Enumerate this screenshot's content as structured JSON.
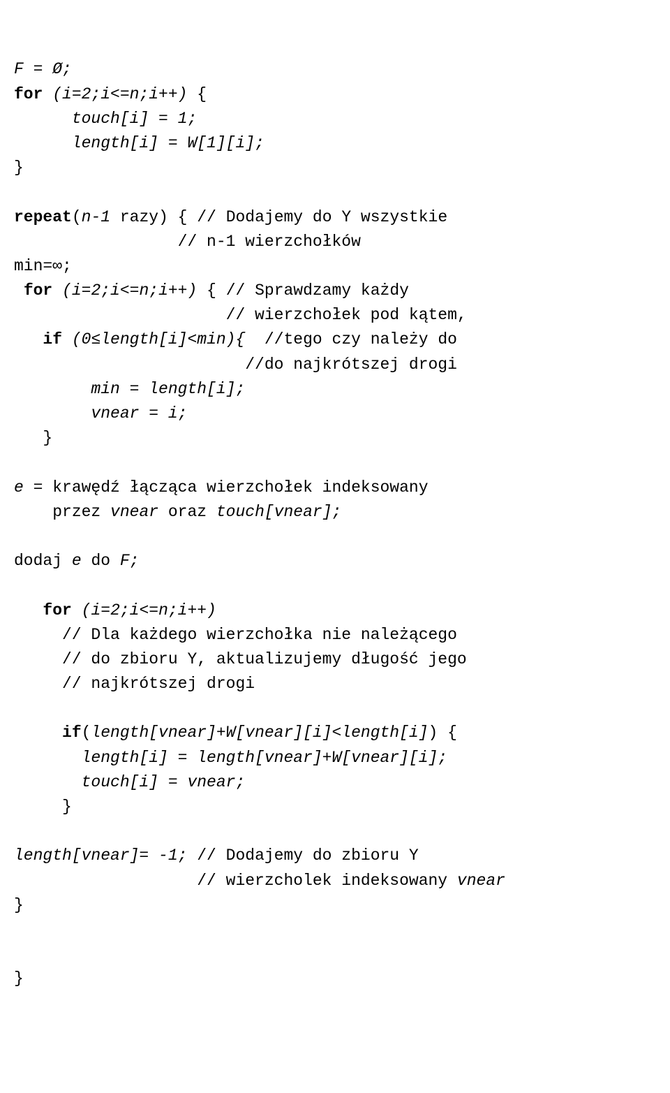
{
  "lines": [
    {
      "segs": [
        {
          "t": "F = Ø;",
          "i": true
        }
      ]
    },
    {
      "segs": [
        {
          "t": "for",
          "b": true
        },
        {
          "t": " "
        },
        {
          "t": "(i=2;i<=n;i++)",
          "i": true
        },
        {
          "t": " {"
        }
      ]
    },
    {
      "segs": [
        {
          "t": "      "
        },
        {
          "t": "touch[i] = 1;",
          "i": true
        }
      ]
    },
    {
      "segs": [
        {
          "t": "      "
        },
        {
          "t": "length[i] = W[1][i];",
          "i": true
        }
      ]
    },
    {
      "segs": [
        {
          "t": "}"
        }
      ]
    },
    {
      "segs": [
        {
          "t": ""
        }
      ]
    },
    {
      "segs": [
        {
          "t": "repeat",
          "b": true
        },
        {
          "t": "("
        },
        {
          "t": "n-1",
          "i": true
        },
        {
          "t": " razy) { // Dodajemy do Y wszystkie"
        }
      ]
    },
    {
      "segs": [
        {
          "t": "                 // n-1 wierzchołków"
        }
      ]
    },
    {
      "segs": [
        {
          "t": "min=∞;"
        }
      ]
    },
    {
      "segs": [
        {
          "t": " "
        },
        {
          "t": "for",
          "b": true
        },
        {
          "t": " "
        },
        {
          "t": "(i=2;i<=n;i++)",
          "i": true
        },
        {
          "t": " { // Sprawdzamy każdy"
        }
      ]
    },
    {
      "segs": [
        {
          "t": "                      // wierzchołek pod kątem,"
        }
      ]
    },
    {
      "segs": [
        {
          "t": "   "
        },
        {
          "t": "if",
          "b": true
        },
        {
          "t": " "
        },
        {
          "t": "(0≤length[i]<min){",
          "i": true
        },
        {
          "t": "  //tego czy należy do"
        }
      ]
    },
    {
      "segs": [
        {
          "t": "                        //do najkrótszej drogi"
        }
      ]
    },
    {
      "segs": [
        {
          "t": "        "
        },
        {
          "t": "min = length[i];",
          "i": true
        }
      ]
    },
    {
      "segs": [
        {
          "t": "        "
        },
        {
          "t": "vnear = i;",
          "i": true
        }
      ]
    },
    {
      "segs": [
        {
          "t": "   }"
        }
      ]
    },
    {
      "segs": [
        {
          "t": ""
        }
      ]
    },
    {
      "segs": [
        {
          "t": "e ",
          "i": true
        },
        {
          "t": "= krawędź łącząca wierzchołek indeksowany"
        }
      ]
    },
    {
      "segs": [
        {
          "t": "    przez "
        },
        {
          "t": "vnear",
          "i": true
        },
        {
          "t": " oraz "
        },
        {
          "t": "touch[vnear];",
          "i": true
        }
      ]
    },
    {
      "segs": [
        {
          "t": ""
        }
      ]
    },
    {
      "segs": [
        {
          "t": "dodaj "
        },
        {
          "t": "e",
          "i": true
        },
        {
          "t": " do "
        },
        {
          "t": "F;",
          "i": true
        }
      ]
    },
    {
      "segs": [
        {
          "t": ""
        }
      ]
    },
    {
      "segs": [
        {
          "t": "   "
        },
        {
          "t": "for",
          "b": true
        },
        {
          "t": " "
        },
        {
          "t": "(i=2;i<=n;i++)",
          "i": true
        }
      ]
    },
    {
      "segs": [
        {
          "t": "     // Dla każdego wierzchołka nie należącego"
        }
      ]
    },
    {
      "segs": [
        {
          "t": "     // do zbioru Y, aktualizujemy długość jego"
        }
      ]
    },
    {
      "segs": [
        {
          "t": "     // najkrótszej drogi"
        }
      ]
    },
    {
      "segs": [
        {
          "t": ""
        }
      ]
    },
    {
      "segs": [
        {
          "t": "     "
        },
        {
          "t": "if",
          "b": true
        },
        {
          "t": "("
        },
        {
          "t": "length[vnear]+W[vnear][i]<length[i]",
          "i": true
        },
        {
          "t": ") {"
        }
      ]
    },
    {
      "segs": [
        {
          "t": "       "
        },
        {
          "t": "length[i] = length[vnear]+W[vnear][i];",
          "i": true
        }
      ]
    },
    {
      "segs": [
        {
          "t": "       "
        },
        {
          "t": "touch[i] = vnear;",
          "i": true
        }
      ]
    },
    {
      "segs": [
        {
          "t": "     }"
        }
      ]
    },
    {
      "segs": [
        {
          "t": ""
        }
      ]
    },
    {
      "segs": [
        {
          "t": "length[vnear]= -1;",
          "i": true
        },
        {
          "t": " // Dodajemy do zbioru Y"
        }
      ]
    },
    {
      "segs": [
        {
          "t": "                   // wierzcholek indeksowany "
        },
        {
          "t": "vnear",
          "i": true
        }
      ]
    },
    {
      "segs": [
        {
          "t": "}"
        }
      ]
    },
    {
      "segs": [
        {
          "t": ""
        }
      ]
    },
    {
      "segs": [
        {
          "t": ""
        }
      ]
    },
    {
      "segs": [
        {
          "t": "}"
        }
      ]
    }
  ]
}
